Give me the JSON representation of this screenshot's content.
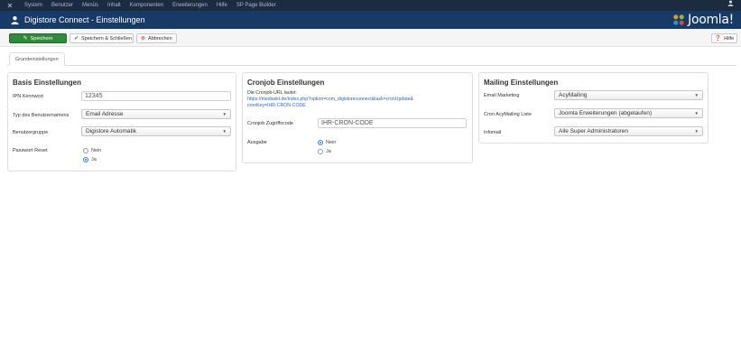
{
  "nav": {
    "items": [
      "System",
      "Benutzer",
      "Menüs",
      "Inhalt",
      "Komponenten",
      "Erweiterungen",
      "Hilfe",
      "SP Page Builder"
    ]
  },
  "header": {
    "title": "Digistore Connect - Einstellungen",
    "logo_text": "Joomla!"
  },
  "toolbar": {
    "save_label": "Speichern",
    "save_close_label": "Speichern & Schließen",
    "cancel_label": "Abbrechen",
    "help_label": "Hilfe"
  },
  "tabs": [
    {
      "label": "Grundeinstellungen",
      "active": true
    }
  ],
  "basis": {
    "title": "Basis Einstellungen",
    "ipn_label": "IPN Kennwort",
    "ipn_value": "12345",
    "username_type_label": "Typ des Benutzernamens",
    "username_type_value": "Email Adresse",
    "group_label": "Benutzergruppe",
    "group_value": "Digistore Automatik",
    "reset_label": "Passwort Reset",
    "reset_options": [
      "Nein",
      "Ja"
    ],
    "reset_selected": "Ja"
  },
  "cronjob": {
    "title": "Cronjob Einstellungen",
    "url_intro": "Die Cronjob-URL lautet:",
    "url_line1": "https://mediaskl.de/index.php?option=com_digistoreconnect&task=cronUpdate&",
    "url_line2": "cronKey=IHR-CRON-CODE",
    "code_label": "Cronjob Zugriffscode",
    "code_value": "IHR-CRON-CODE",
    "output_label": "Ausgabe",
    "output_options": [
      "Nein",
      "Ja"
    ],
    "output_selected": "Nein"
  },
  "mailing": {
    "title": "Mailing Einstellungen",
    "email_marketing_label": "Email Marketing",
    "email_marketing_value": "AcyMailing",
    "cron_list_label": "Cron AcyMailing Liste",
    "cron_list_value": "Joomla Erweiterungen (abgelaufen)",
    "inform_label": "Infomail",
    "inform_value": "Alle Super Administratoren"
  },
  "colors": {
    "nav_bg": "#1b2b40",
    "header_bg": "#173a66",
    "save_bg": "#2f8a3a",
    "cancel_icon": "#c0392b",
    "joomla_orange": "#f28c1d",
    "link": "#2a69b8"
  }
}
